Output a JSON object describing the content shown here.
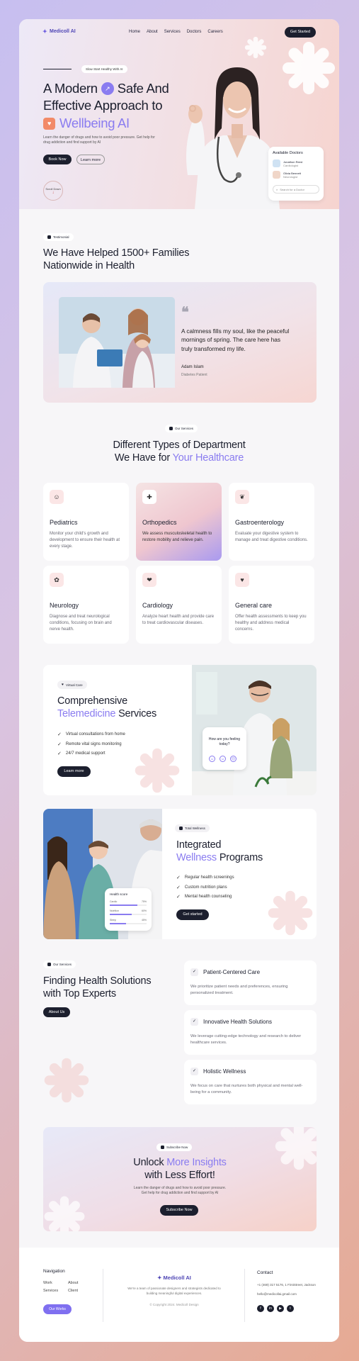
{
  "nav": {
    "logo": "Medicoll AI",
    "links": [
      "Home",
      "About",
      "Services",
      "Doctors",
      "Careers"
    ],
    "cta": "Get Started"
  },
  "hero": {
    "tag": "Slow Start Healthy With AI",
    "line1a": "A Modern",
    "line1b": "Safe And",
    "line2": "Effective Approach to",
    "line3": "Wellbeing AI",
    "desc": "Learn the danger of drugs and how to avoid poor pressure. Get help for drug addiction and find support by AI",
    "btn1": "Book Now",
    "btn2": "Learn more",
    "scroll": "Scroll Down",
    "doctors_title": "Available Doctors",
    "doctors": [
      {
        "name": "Jonathon Reed",
        "role": "Cardiologist"
      },
      {
        "name": "Olivia Bennett",
        "role": "Neurologist"
      }
    ],
    "search_placeholder": "Search for a Doctor"
  },
  "families": {
    "badge": "Testimonial",
    "title1": "We Have Helped 1500+ Families",
    "title2": "Nationwide in Health",
    "quote": "A calmness fills my soul, like the peaceful mornings of spring. The care here has truly transformed my life.",
    "name": "Adam Islam",
    "role": "Diabetes Patient"
  },
  "services": {
    "badge": "Our Services",
    "title1": "Different Types of Department",
    "title2a": "We Have for",
    "title2b": "Your Healthcare",
    "items": [
      {
        "title": "Pediatrics",
        "desc": "Monitor your child's growth and development to ensure their health at every stage.",
        "icon": "child-icon"
      },
      {
        "title": "Orthopedics",
        "desc": "We assess musculoskeletal health to restore mobility and relieve pain.",
        "icon": "bone-icon"
      },
      {
        "title": "Gastroenterology",
        "desc": "Evaluate your digestive system to manage and treat digestive conditions.",
        "icon": "stomach-icon"
      },
      {
        "title": "Neurology",
        "desc": "Diagnose and treat neurological conditions, focusing on brain and nerve health.",
        "icon": "brain-icon"
      },
      {
        "title": "Cardiology",
        "desc": "Analyze heart health and provide care to treat cardiovascular diseases.",
        "icon": "heart-organ-icon"
      },
      {
        "title": "General care",
        "desc": "Offer health assessments to keep you healthy and address medical concerns.",
        "icon": "heart-icon"
      }
    ]
  },
  "tele": {
    "badge": "Virtual Care",
    "title1": "Comprehensive",
    "title2a": "Telemedicine",
    "title2b": "Services",
    "items": [
      "Virtual consultations from home",
      "Remote vital signs monitoring",
      "24/7 medical support"
    ],
    "btn": "Learn more",
    "bubble": "How are you feeling today?"
  },
  "wellness": {
    "badge": "Total Wellness",
    "title1": "Integrated",
    "title2a": "Wellness",
    "title2b": "Programs",
    "items": [
      "Regular health screenings",
      "Custom nutrition plans",
      "Mental health counseling"
    ],
    "btn": "Get started",
    "card_title": "Health score",
    "bars": [
      {
        "label": "Cardio",
        "value": "75%"
      },
      {
        "label": "Nutrition",
        "value": "60%"
      },
      {
        "label": "Sleep",
        "value": "45%"
      }
    ]
  },
  "solutions": {
    "badge": "Our Services",
    "title1": "Finding Health Solutions",
    "title2": "with Top Experts",
    "btn": "About Us",
    "items": [
      {
        "title": "Patient-Centered Care",
        "desc": "We prioritize patient needs and preferences, ensuring personalized treatment."
      },
      {
        "title": "Innovative Health Solutions",
        "desc": "We leverage cutting-edge technology and research to deliver healthcare services."
      },
      {
        "title": "Holistic Wellness",
        "desc": "We focus on care that nurtures both physical and mental well-being for a community."
      }
    ]
  },
  "insights": {
    "badge": "Subscribe Now",
    "title1a": "Unlock",
    "title1b": "More Insights",
    "title2": "with Less Effort!",
    "desc1": "Learn the danger of drugs and how to avoid poor pressure.",
    "desc2": "Get help for drug addiction and find support by AI",
    "btn": "Subscribe Now"
  },
  "footer": {
    "nav_title": "Navigation",
    "links": [
      "Work",
      "About",
      "Services",
      "Client"
    ],
    "btn": "Our Works",
    "logo": "Medicoll AI",
    "about": "We're a team of passionate designers and strategists dedicated to building meaningful digital experiences.",
    "copyright": "© Copyright 2024. Medicoll Design",
    "contact_title": "Contact",
    "phone": "+1 (469) 317 5176, 1 FirstStreet, Jackson",
    "email": "hello@medicollai.gmail.com",
    "colors": {
      "accent": "#8a7cf0",
      "dark": "#1c1f2e"
    }
  }
}
